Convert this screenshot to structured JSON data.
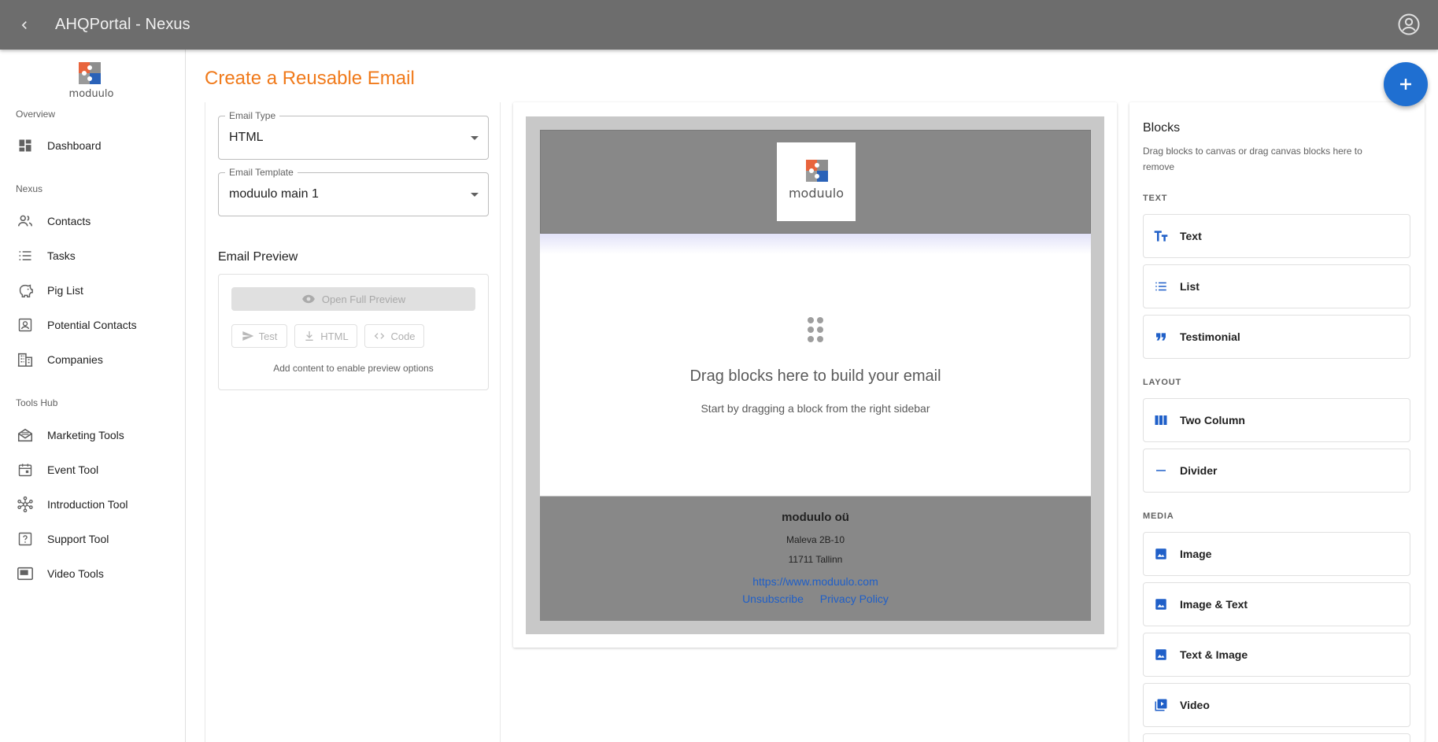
{
  "app": {
    "title": "AHQPortal - Nexus"
  },
  "brand": {
    "name": "moduulo"
  },
  "sidebar": {
    "sections": [
      {
        "label": "Overview",
        "items": [
          {
            "label": "Dashboard",
            "icon": "dashboard-icon"
          }
        ]
      },
      {
        "label": "Nexus",
        "items": [
          {
            "label": "Contacts",
            "icon": "people-icon"
          },
          {
            "label": "Tasks",
            "icon": "list-icon"
          },
          {
            "label": "Pig List",
            "icon": "piggy-bank-icon"
          },
          {
            "label": "Potential Contacts",
            "icon": "contact-card-icon"
          },
          {
            "label": "Companies",
            "icon": "building-icon"
          }
        ]
      },
      {
        "label": "Tools Hub",
        "items": [
          {
            "label": "Marketing Tools",
            "icon": "mail-open-icon"
          },
          {
            "label": "Event Tool",
            "icon": "calendar-icon"
          },
          {
            "label": "Introduction Tool",
            "icon": "hub-icon"
          },
          {
            "label": "Support Tool",
            "icon": "help-box-icon"
          },
          {
            "label": "Video Tools",
            "icon": "video-frame-icon"
          }
        ]
      }
    ]
  },
  "page": {
    "title": "Create a Reusable Email"
  },
  "form": {
    "email_type": {
      "label": "Email Type",
      "value": "HTML"
    },
    "email_template": {
      "label": "Email Template",
      "value": "moduulo main 1"
    }
  },
  "preview": {
    "title": "Email Preview",
    "open_full": "Open Full Preview",
    "test": "Test",
    "html": "HTML",
    "code": "Code",
    "hint": "Add content to enable preview options"
  },
  "canvas": {
    "drop_title": "Drag blocks here to build your email",
    "drop_subtitle": "Start by dragging a block from the right sidebar",
    "footer": {
      "company": "moduulo oü",
      "address1": "Maleva 2B-10",
      "address2": "11711 Tallinn",
      "website": "https://www.moduulo.com",
      "unsubscribe": "Unsubscribe",
      "privacy": "Privacy Policy"
    }
  },
  "blocks": {
    "title": "Blocks",
    "description": "Drag blocks to canvas or drag canvas blocks here to remove",
    "groups": {
      "text": {
        "label": "TEXT",
        "items": [
          "Text",
          "List",
          "Testimonial"
        ]
      },
      "layout": {
        "label": "LAYOUT",
        "items": [
          "Two Column",
          "Divider"
        ]
      },
      "media": {
        "label": "MEDIA",
        "items": [
          "Image",
          "Image & Text",
          "Text & Image",
          "Video"
        ]
      }
    }
  },
  "colors": {
    "accent": "#f07a1b",
    "primary": "#1f6fd1",
    "topbar": "#6d6d6d",
    "link": "#1f5fc8"
  }
}
